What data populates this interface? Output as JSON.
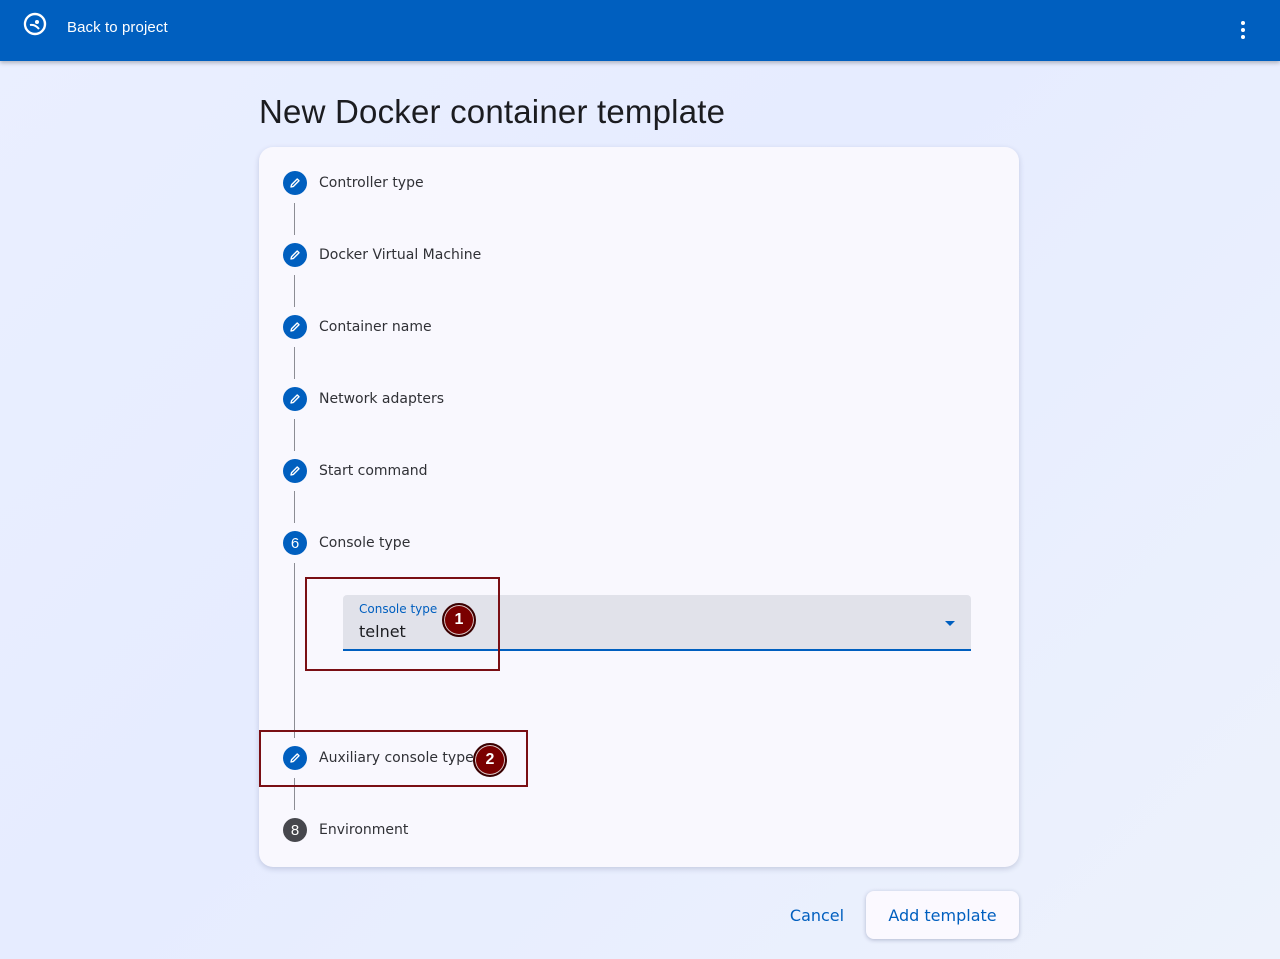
{
  "topbar": {
    "back_label": "Back to project",
    "logo_icon": "gns3-chameleon-icon",
    "menu_icon": "more-vert-icon"
  },
  "page": {
    "title": "New Docker container template"
  },
  "stepper": {
    "steps": [
      {
        "label": "Controller type",
        "indicator": "edit",
        "state": "completed"
      },
      {
        "label": "Docker Virtual Machine",
        "indicator": "edit",
        "state": "completed"
      },
      {
        "label": "Container name",
        "indicator": "edit",
        "state": "completed"
      },
      {
        "label": "Network adapters",
        "indicator": "edit",
        "state": "completed"
      },
      {
        "label": "Start command",
        "indicator": "edit",
        "state": "completed"
      },
      {
        "label": "Console type",
        "indicator": "6",
        "state": "active"
      },
      {
        "label": "Auxiliary console type",
        "indicator": "edit",
        "state": "completed"
      },
      {
        "label": "Environment",
        "indicator": "8",
        "state": "inactive"
      }
    ]
  },
  "console_select": {
    "label": "Console type",
    "value": "telnet"
  },
  "annotations": {
    "marker_1": "1",
    "marker_2": "2",
    "color": "#7a0f14"
  },
  "actions": {
    "cancel_label": "Cancel",
    "add_label": "Add template"
  },
  "colors": {
    "primary": "#005fbf",
    "inactive_step": "#46474d"
  }
}
